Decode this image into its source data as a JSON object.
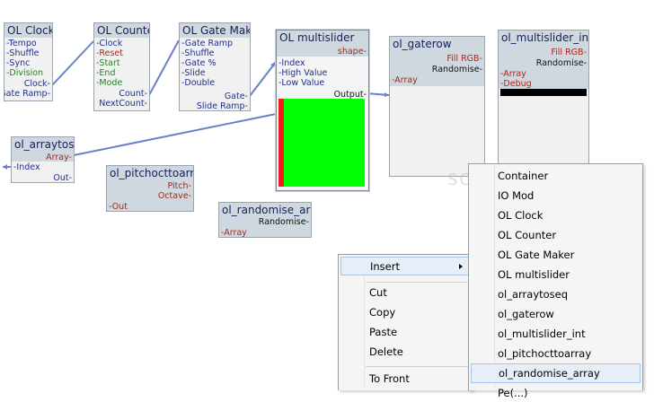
{
  "modules": {
    "ol_clock": {
      "title": "OL Clock",
      "inputs": [
        "-Tempo",
        "-Shuffle",
        "-Sync",
        "-Division"
      ],
      "outputs": [
        "Clock-",
        "Gate Ramp-"
      ]
    },
    "ol_counter": {
      "title": "OL Counter",
      "inputs": [
        "-Clock",
        "-Reset",
        "-Start",
        "-End",
        "-Mode"
      ],
      "outputs": [
        "Count-",
        "NextCount-"
      ]
    },
    "ol_gate_maker": {
      "title": "OL Gate Maker",
      "inputs": [
        "-Gate Ramp",
        "-Shuffle",
        "-Gate %",
        "-Slide",
        "-Double"
      ],
      "outputs": [
        "Gate-",
        "Slide Ramp-"
      ]
    },
    "ol_multislider": {
      "title": "OL multislider",
      "top_output": "shape-",
      "inputs": [
        "-Index",
        "-High Value",
        "-Low Value"
      ],
      "outputs": [
        "Output-"
      ]
    },
    "ol_gaterow": {
      "title": "ol_gaterow",
      "outputs": [
        "Fill RGB-",
        "Randomise-"
      ],
      "inputs": [
        "-Array"
      ]
    },
    "ol_multislider_int": {
      "title": "ol_multislider_int",
      "outputs": [
        "Fill RGB-",
        "Randomise-"
      ],
      "inputs": [
        "-Array",
        "-Debug"
      ]
    },
    "ol_arraytoseq": {
      "title": "ol_arraytoseq",
      "outputs_top": [
        "Array-"
      ],
      "inputs": [
        "-Index"
      ],
      "outputs": [
        "Out-"
      ]
    },
    "ol_pitchocttoarray": {
      "title": "ol_pitchocttoarray",
      "outputs": [
        "Pitch-",
        "Octave-"
      ],
      "inputs": [
        "-Out"
      ]
    },
    "ol_randomise_array": {
      "title": "ol_randomise_array",
      "outputs": [
        "Randomise-"
      ],
      "inputs": [
        "-Array"
      ]
    }
  },
  "colors": {
    "slider_fill": "#00ff00",
    "slider_bar": "#ee1c1c",
    "wire": "#6a80c8",
    "title_bg": "#cfd8df"
  },
  "context_menu": {
    "items": [
      "Insert",
      "Cut",
      "Copy",
      "Paste",
      "Delete",
      "To Front"
    ],
    "insert_arrow_icon": "chevron-right-icon"
  },
  "submenu": {
    "items": [
      "Container",
      "IO Mod",
      "OL Clock",
      "OL Counter",
      "OL Gate Maker",
      "OL multislider",
      "ol_arraytoseq",
      "ol_gaterow",
      "ol_multislider_int",
      "ol_pitchocttoarray",
      "ol_randomise_array",
      "Pe(...)"
    ],
    "highlighted": "ol_randomise_array"
  },
  "watermark": "SOFTPEDIA"
}
